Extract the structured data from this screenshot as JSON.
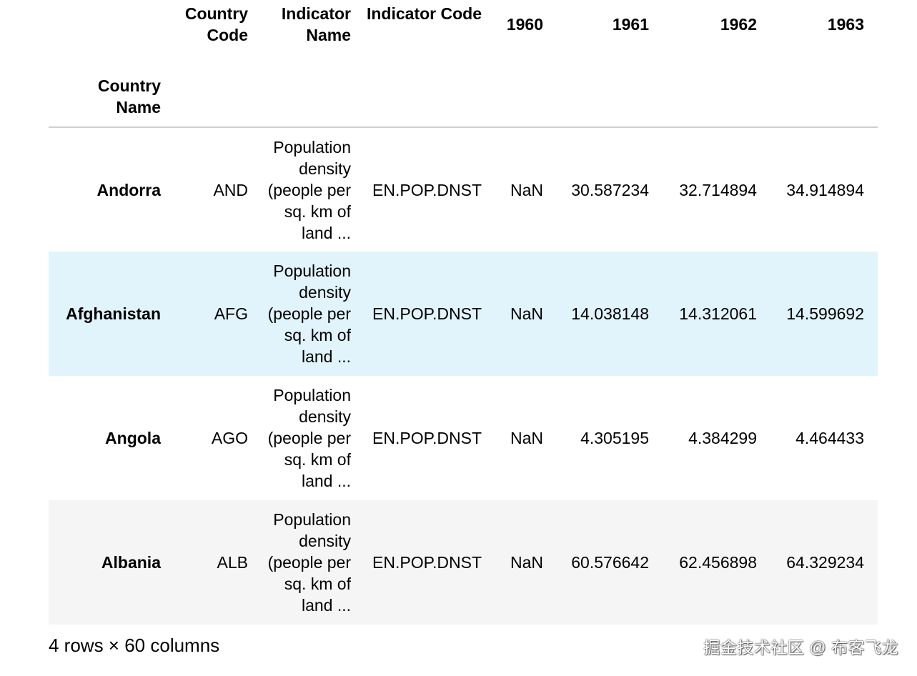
{
  "table": {
    "index_name": "Country Name",
    "columns": [
      "Country Code",
      "Indicator Name",
      "Indicator Code",
      "1960",
      "1961",
      "1962",
      "1963"
    ],
    "rows": [
      {
        "index": "Andorra",
        "country_code": "AND",
        "indicator_name": "Population density (people per sq. km of land ...",
        "indicator_code": "EN.POP.DNST",
        "y1960": "NaN",
        "y1961": "30.587234",
        "y1962": "32.714894",
        "y1963": "34.914894"
      },
      {
        "index": "Afghanistan",
        "country_code": "AFG",
        "indicator_name": "Population density (people per sq. km of land ...",
        "indicator_code": "EN.POP.DNST",
        "y1960": "NaN",
        "y1961": "14.038148",
        "y1962": "14.312061",
        "y1963": "14.599692"
      },
      {
        "index": "Angola",
        "country_code": "AGO",
        "indicator_name": "Population density (people per sq. km of land ...",
        "indicator_code": "EN.POP.DNST",
        "y1960": "NaN",
        "y1961": "4.305195",
        "y1962": "4.384299",
        "y1963": "4.464433"
      },
      {
        "index": "Albania",
        "country_code": "ALB",
        "indicator_name": "Population density (people per sq. km of land ...",
        "indicator_code": "EN.POP.DNST",
        "y1960": "NaN",
        "y1961": "60.576642",
        "y1962": "62.456898",
        "y1963": "64.329234"
      }
    ],
    "highlight_color": "#e1f3fb",
    "stripe_color": "#f5f5f5"
  },
  "footer": {
    "shape_text": "4 rows × 60 columns"
  },
  "watermark": {
    "text": "掘金技术社区 @ 布客飞龙"
  }
}
